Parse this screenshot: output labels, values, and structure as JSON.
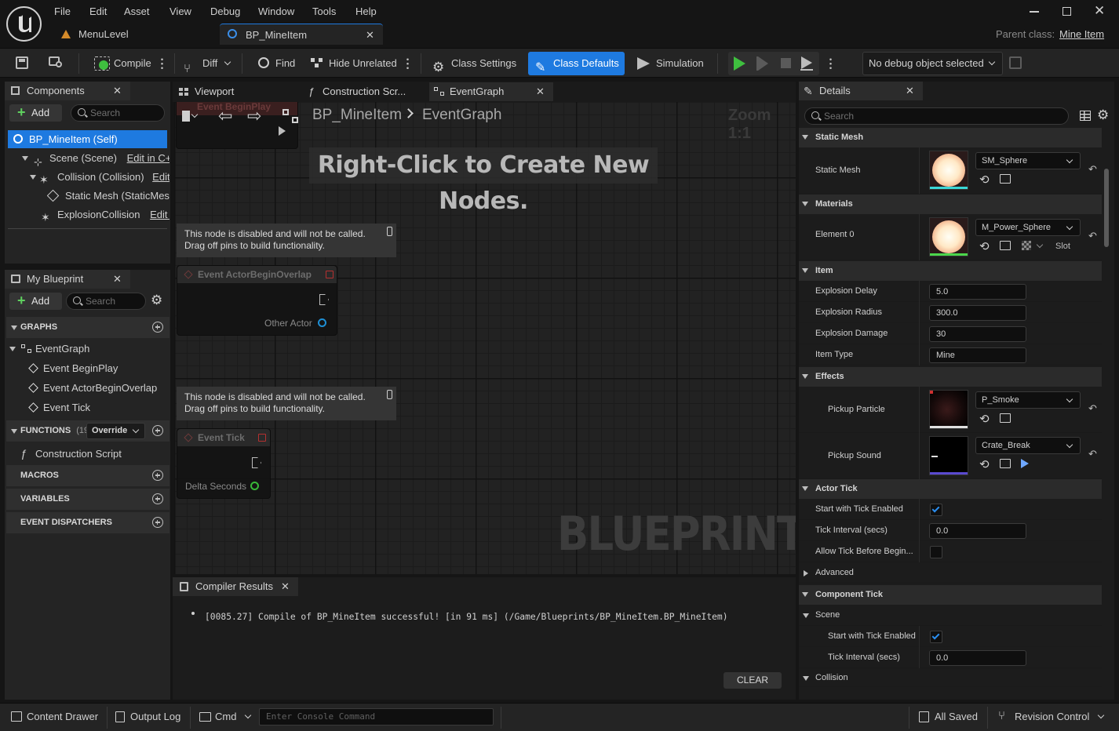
{
  "menu": [
    "File",
    "Edit",
    "Asset",
    "View",
    "Debug",
    "Window",
    "Tools",
    "Help"
  ],
  "doc_tabs": [
    {
      "label": "MenuLevel"
    },
    {
      "label": "BP_MineItem"
    }
  ],
  "parent_class": {
    "label": "Parent class:",
    "value": "Mine Item"
  },
  "toolbar": {
    "compile": "Compile",
    "diff": "Diff",
    "find": "Find",
    "hide_unrelated": "Hide Unrelated",
    "class_settings": "Class Settings",
    "class_defaults": "Class Defaults",
    "simulation": "Simulation",
    "debug_object": "No debug object selected"
  },
  "components": {
    "tab": "Components",
    "add": "Add",
    "search_placeholder": "Search",
    "items": [
      {
        "label": "BP_MineItem (Self)",
        "edit": ""
      },
      {
        "label": "Scene (Scene)",
        "edit": "Edit in C++"
      },
      {
        "label": "Collision (Collision)",
        "edit": "Edit"
      },
      {
        "label": "Static Mesh (StaticMes",
        "edit": ""
      },
      {
        "label": "ExplosionCollision",
        "edit": "Edit ir"
      }
    ]
  },
  "my_blueprint": {
    "tab": "My Blueprint",
    "add": "Add",
    "search_placeholder": "Search",
    "graphs_header": "GRAPHS",
    "event_graph": "EventGraph",
    "events": [
      "Event BeginPlay",
      "Event ActorBeginOverlap",
      "Event Tick"
    ],
    "functions_header": "FUNCTIONS",
    "functions_count": "(19",
    "override": "Override",
    "construction_script": "Construction Script",
    "macros": "MACROS",
    "variables": "VARIABLES",
    "event_dispatchers": "EVENT DISPATCHERS"
  },
  "graph_tabs": [
    "Viewport",
    "Construction Scr...",
    "EventGraph"
  ],
  "graph": {
    "breadcrumb_bp": "BP_MineItem",
    "breadcrumb_graph": "EventGraph",
    "zoom": "Zoom 1:1",
    "hint": "Right-Click to Create New Nodes.",
    "watermark": "BLUEPRINT",
    "partial_node": "Event BeginPlay",
    "comment_line1": "This node is disabled and will not be called.",
    "comment_line2": "Drag off pins to build functionality.",
    "node_overlap": "Event ActorBeginOverlap",
    "pin_other_actor": "Other Actor",
    "node_tick": "Event Tick",
    "pin_delta": "Delta Seconds"
  },
  "compiler": {
    "tab": "Compiler Results",
    "message": "[0085.27] Compile of BP_MineItem successful! [in 91 ms] (/Game/Blueprints/BP_MineItem.BP_MineItem)",
    "clear": "CLEAR"
  },
  "details": {
    "tab": "Details",
    "search_placeholder": "Search",
    "cat_static_mesh": "Static Mesh",
    "static_mesh_label": "Static Mesh",
    "static_mesh_value": "SM_Sphere",
    "cat_materials": "Materials",
    "element0_label": "Element 0",
    "element0_value": "M_Power_Sphere",
    "slot": "Slot",
    "cat_item": "Item",
    "explosion_delay_label": "Explosion Delay",
    "explosion_delay": "5.0",
    "explosion_radius_label": "Explosion Radius",
    "explosion_radius": "300.0",
    "explosion_damage_label": "Explosion Damage",
    "explosion_damage": "30",
    "item_type_label": "Item Type",
    "item_type": "Mine",
    "cat_effects": "Effects",
    "pickup_particle_label": "Pickup Particle",
    "pickup_particle": "P_Smoke",
    "pickup_sound_label": "Pickup Sound",
    "pickup_sound": "Crate_Break",
    "cat_actor_tick": "Actor Tick",
    "start_tick_label": "Start with Tick Enabled",
    "tick_interval_label": "Tick Interval (secs)",
    "tick_interval": "0.0",
    "allow_tick_label": "Allow Tick Before Begin...",
    "advanced": "Advanced",
    "cat_component_tick": "Component Tick",
    "scene": "Scene",
    "scene_start_tick_label": "Start with Tick Enabled",
    "scene_tick_interval_label": "Tick Interval (secs)",
    "scene_tick_interval": "0.0",
    "collision": "Collision"
  },
  "statusbar": {
    "content_drawer": "Content Drawer",
    "output_log": "Output Log",
    "cmd": "Cmd",
    "console_placeholder": "Enter Console Command",
    "all_saved": "All Saved",
    "revision_control": "Revision Control"
  },
  "colors": {
    "accent": "#1e7ae0",
    "play": "#3fbf3f",
    "link_blue": "#2a8ef0"
  }
}
